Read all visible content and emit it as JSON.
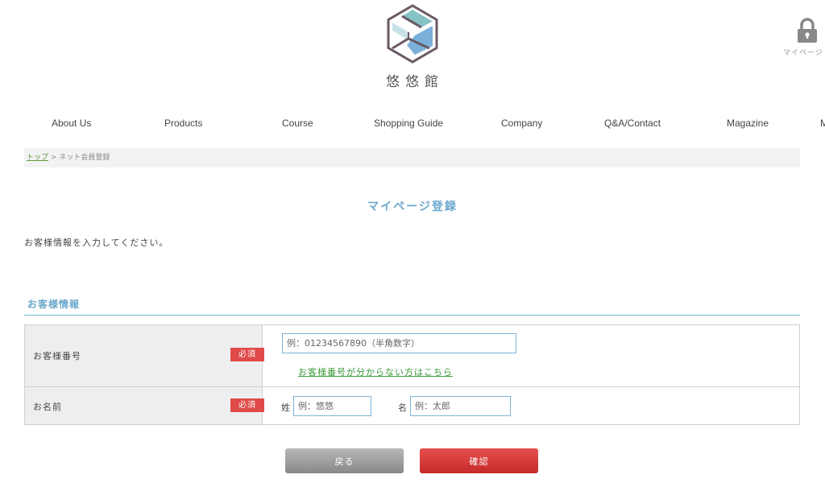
{
  "brand": {
    "name": "悠悠館"
  },
  "mypage": {
    "label": "マイページ"
  },
  "nav": {
    "items": [
      "About Us",
      "Products",
      "Course",
      "Shopping Guide",
      "Company",
      "Q&A/Contact",
      "Magazine",
      "M"
    ]
  },
  "breadcrumb": {
    "home": "トップ",
    "separator": ">",
    "current": "ネット会員登録"
  },
  "page": {
    "title": "マイページ登録",
    "intro": "お客様情報を入力してください。"
  },
  "section": {
    "title": "お客様情報"
  },
  "form": {
    "required_badge": "必須",
    "customer_number": {
      "label": "お客様番号",
      "placeholder": "例：01234567890（半角数字）",
      "help_link": "お客様番号が分からない方はこちら"
    },
    "name": {
      "label": "お名前",
      "last_label": "姓",
      "last_placeholder": "例：悠悠",
      "first_label": "名",
      "first_placeholder": "例：太郎"
    }
  },
  "buttons": {
    "back": "戻る",
    "confirm": "確認"
  },
  "colors": {
    "accent": "#6aa8cc",
    "required": "#e04a4a",
    "confirm": "#d93b3b",
    "back": "#9e9e9e",
    "link": "#3a9a3a"
  }
}
